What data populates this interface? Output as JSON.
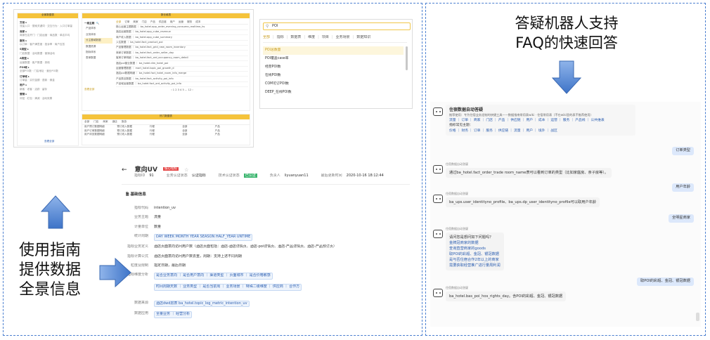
{
  "left_caption": "使用指南\n提供数据\n全景信息",
  "right_caption": "答疑机器人支持\nFAQ的快速回答",
  "catalog": {
    "header": "全景数据表",
    "left_groups": [
      {
        "title": "交易 ▸",
        "items": "流量入口 · 搜索关键词 · 交互行为 · 入口订单量"
      },
      {
        "title": "商家 ▸",
        "items": "商家在店开门 · 门店运营 · 商品数 · 单店平均"
      },
      {
        "title": "服务 ▸",
        "items": "以订单 · 客户满意度 · 投诉率 · 商户应答"
      },
      {
        "title": "S类型 ▸",
        "items": "门店数据 · 活动数据 · 营销活动"
      },
      {
        "title": "A类型 ▸",
        "items": "运营数据 · 客户数据 · 其他"
      },
      {
        "title": "POI域 ▸",
        "items": "全部POI数 · 门店地址 · 营业POI数"
      },
      {
        "title": "订单域 ▸",
        "items": "订单量 · 实付金额 · 退款 · 佣金"
      },
      {
        "title": "用户 ▸",
        "items": "新客 · 老客 · 活跃 · 留存"
      },
      {
        "title": "营销 ▸",
        "items": "补贴 · 红包 · 满减 · 活动效果"
      }
    ],
    "left_link": "查看全部",
    "mid_header": "数仓维表",
    "mid_items": [
      "产品体系",
      "业务体系",
      "分主题域数据",
      "数据资源",
      "指标体系",
      "表单数据"
    ],
    "mid_link": "查看全部",
    "tabs": [
      "全部",
      "订单",
      "商家",
      "门店",
      "产品",
      "供应链",
      "用户",
      "运营",
      "服务",
      "成本"
    ],
    "table_lines": [
      "核心运营主题数据 ｜ ba_hotel.app_order_evening_consume_realtime_hs",
      "酒店运营数据 ｜ ba_hotel.app_cube_revenue",
      "商户收入数据 ｜ ba_hotel.app_cube_summary",
      "入住数据 ｜ ba_hotel.fact_product_poi",
      "产品管理数据 ｜ ba_hotel.fact_grid_new_room_inventory",
      "商家订单数据 ｜ ba_hotel.fact_order_seller_day",
      "客房订单明细 ｜ ba_hotel.fact_ord_occupancy_room_detail",
      "酒店poi营业数据 ｜ ba_hotel.dim_hotel_poi",
      "运营管理数据 ｜ mart_hotel.topic_poi_growth_d",
      "酒店poi数据明细 ｜ ba_hotel.fact_hotel_room_info_merge",
      "产品类目数据 ｜ ba_hotel.fact_activity_poi_info",
      "产品域运营数据 ｜ ba_hotel.fact_ord_activity_poi_info"
    ],
    "pagination": "‹ 1 2 3 4 5 … 12 ›",
    "bottom_header": "热门数据表",
    "bottom_tabs": [
      "全部",
      "门店",
      "商家",
      "酒店",
      "旅游"
    ],
    "bottom_rows": [
      [
        "用户预订数据明细",
        "预订收入数据",
        "行程",
        "全部",
        "产品"
      ],
      [
        "用户订单数据明细",
        "预订收入数据",
        "行程",
        "全部",
        "产品"
      ],
      [
        "用户浏览数据明细",
        "预订收入数据",
        "行程",
        "全部",
        "产品"
      ]
    ]
  },
  "search": {
    "query": "POI",
    "tabs": [
      "全部",
      "指标",
      "数据表",
      "维度",
      "项目",
      "业务场景",
      "数据知识"
    ],
    "results": [
      "POI总数量",
      "POI覆盖case率",
      "经营POI数",
      "在线POI数",
      "COM可订POI数",
      "DEEP_在线POI数"
    ]
  },
  "detail": {
    "back": "←",
    "title": "意向UV",
    "badge": "核心指标",
    "star": "☆",
    "meta": [
      {
        "label": "指标ID",
        "value": "91"
      },
      {
        "label": "业务认证状态",
        "value": "认证指标"
      },
      {
        "label": "技术认证状态",
        "value": "已认证"
      },
      {
        "label": "负责人",
        "value": "liyuanyuan11"
      },
      {
        "label": "最后更新时间",
        "value": "2020-10-16 18:12:44"
      }
    ],
    "section_title": "基础信息",
    "rows": [
      {
        "label": "指标代码",
        "value": "intention_uv"
      },
      {
        "label": "业务主题",
        "value": "流量"
      },
      {
        "label": "计量单位",
        "value": "数量"
      },
      {
        "label": "统计周期",
        "value": "DAY  WEEK  MONTH  YEAR  SEASON  HALF_YEAR  UNTIME"
      },
      {
        "label": "指标业务定义",
        "value": "酒店页面意向访问用户数（酒店页面包括：酒店-酒店详情页、酒店-poi详情页、酒店-产品详情页、酒店-产品预订页）"
      },
      {
        "label": "指标计算公式",
        "value": "酒店页面意向访问用户数去重，周期：支持上述不同周期"
      },
      {
        "label": "粒度及限制",
        "value": "指定日期，最后日期"
      },
      {
        "label": "指标维度分析",
        "value": "是否业务意向 ｜ 是否用户意向 ｜ 渠道类型 ｜ 页面城市 ｜ 是否价格敏感"
      },
      {
        "label": "",
        "value": "时间周期天数 ｜ 业务类型 ｜ 是否当前周 ｜ 业务场景 ｜ 特殊二级维度 ｜ 供应商 ｜ 合作方"
      },
      {
        "label": "数据来源",
        "value": "酒店dwd层表 ba_hotel.topic_log_metric_intention_uv"
      },
      {
        "label": "数据应用",
        "value": "全量业务 ｜ 经营分析"
      }
    ]
  },
  "chat": {
    "title": "住宿数据自动答疑",
    "intro": "推荐使用：专为住宿业务定制的快捷工具——数据指南常用表wiki · 住宿常用表（不在wiki里的表不推荐使用）",
    "intro_links": "流量 ｜ 订单 ｜ 商家 ｜ 门店 ｜ 产品 ｜ 供应链 ｜ 用户 ｜ 成本 ｜ 运营 ｜ 服务 ｜ 产品线 ｜ 公共维表",
    "intro_sub": "指标常见主题：",
    "intro_links2": "价格 ｜ 财务 ｜ 订单 ｜ 服务 ｜ 供应链 ｜ 流量 ｜ 用户 ｜ 境外 ｜ 战区",
    "bot_name": "住宿数据自动答疑",
    "msgs": [
      {
        "side": "r",
        "text": "订单类型"
      },
      {
        "side": "l",
        "text": "通过ba_hotel.fact_order_trade room_name表可以看到订单的类型（比如家庭房、亲子房等）。"
      },
      {
        "side": "r",
        "text": "用户年龄"
      },
      {
        "side": "l",
        "text": "ba_ups.user_identityno_profile、ba_ups.dp_user_identityno_profile可以取用户年龄"
      },
      {
        "side": "r",
        "text": "全明星商家"
      },
      {
        "side": "l",
        "text": "请问您是想问如下问题吗？"
      },
      {
        "side": "r",
        "text": "取POI的彩超、金冠、银冠数据"
      },
      {
        "side": "l",
        "text": "ba_hotel.bas_poi_hos_rights_day。含POI的彩超、金冠、银冠数据"
      }
    ],
    "suggest": [
      "金牌冠商家的数据",
      "查询直营商家的goods",
      "取POI的彩超、金冠、银冠数据",
      "是与否住宿合作2年以上的商家",
      "需要获取经营推广进行量周利润"
    ]
  }
}
